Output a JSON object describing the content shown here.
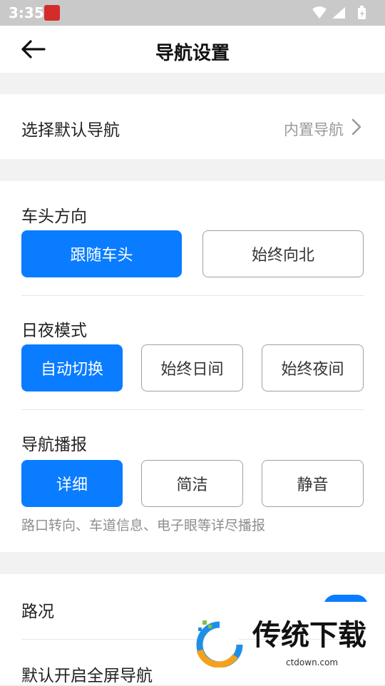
{
  "status": {
    "time": "3:35"
  },
  "header": {
    "title": "导航设置"
  },
  "default_nav": {
    "label": "选择默认导航",
    "value": "内置导航"
  },
  "heading": {
    "title": "车头方向",
    "options": [
      "跟随车头",
      "始终向北"
    ],
    "selected": "跟随车头"
  },
  "day_night": {
    "title": "日夜模式",
    "options": [
      "自动切换",
      "始终日间",
      "始终夜间"
    ],
    "selected": "自动切换"
  },
  "broadcast": {
    "title": "导航播报",
    "options": [
      "详细",
      "简洁",
      "静音"
    ],
    "selected": "详细",
    "hint": "路口转向、车道信息、电子眼等详尽播报"
  },
  "traffic": {
    "label": "路况",
    "toggle_on": true
  },
  "fullscreen": {
    "label": "默认开启全屏导航"
  },
  "watermark": {
    "brand": "传统下载",
    "url": "ctdown.com"
  },
  "colors": {
    "accent": "#0a7cff"
  }
}
